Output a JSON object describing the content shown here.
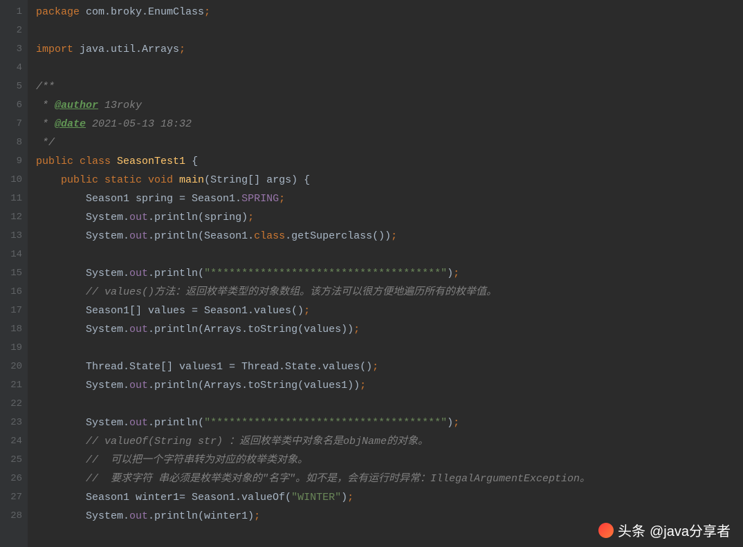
{
  "gutter": {
    "start": 1,
    "end": 28
  },
  "code": {
    "l1": {
      "a": "package ",
      "b": "com.broky.EnumClass",
      "c": ";"
    },
    "l3": {
      "a": "import ",
      "b": "java.util.Arrays",
      "c": ";"
    },
    "l5": "/**",
    "l6": {
      "pre": " * ",
      "tag": "@author",
      "txt": " 13roky"
    },
    "l7": {
      "pre": " * ",
      "tag": "@date",
      "txt": " 2021-05-13 18:32"
    },
    "l8": " */",
    "l9": {
      "a": "public class ",
      "b": "SeasonTest1 ",
      "c": "{"
    },
    "l10": {
      "a": "    ",
      "b": "public static void ",
      "c": "main",
      "d": "(String[] args) {"
    },
    "l11": {
      "a": "        Season1 spring = Season1.",
      "b": "SPRING",
      "c": ";"
    },
    "l12": {
      "a": "        System.",
      "b": "out",
      "c": ".println(spring)",
      "d": ";"
    },
    "l13": {
      "a": "        System.",
      "b": "out",
      "c": ".println(Season1.",
      "d": "class",
      "e": ".getSuperclass())",
      "f": ";"
    },
    "l15": {
      "a": "        System.",
      "b": "out",
      "c": ".println(",
      "d": "\"*************************************\"",
      "e": ")",
      "f": ";"
    },
    "l16": "        // values()方法：返回枚举类型的对象数组。该方法可以很方便地遍历所有的枚举值。",
    "l17": {
      "a": "        Season1[] values = Season1.values()",
      "b": ";"
    },
    "l18": {
      "a": "        System.",
      "b": "out",
      "c": ".println(Arrays.toString(values))",
      "d": ";"
    },
    "l20": {
      "a": "        Thread.State[] values1 = Thread.State.values()",
      "b": ";"
    },
    "l21": {
      "a": "        System.",
      "b": "out",
      "c": ".println(Arrays.toString(values1))",
      "d": ";"
    },
    "l23": {
      "a": "        System.",
      "b": "out",
      "c": ".println(",
      "d": "\"*************************************\"",
      "e": ")",
      "f": ";"
    },
    "l24": "        // valueOf(String str) ：返回枚举类中对象名是objName的对象。",
    "l25": "        //  可以把一个字符串转为对应的枚举类对象。",
    "l26": "        //  要求字符 串必须是枚举类对象的\"名字\"。如不是，会有运行时异常：IllegalArgumentException。",
    "l27": {
      "a": "        Season1 winter1= Season1.valueOf(",
      "b": "\"WINTER\"",
      "c": ")",
      "d": ";"
    },
    "l28": {
      "a": "        System.",
      "b": "out",
      "c": ".println(winter1)",
      "d": ";"
    }
  },
  "watermark": {
    "brand": "头条",
    "handle": "@java分享者"
  }
}
